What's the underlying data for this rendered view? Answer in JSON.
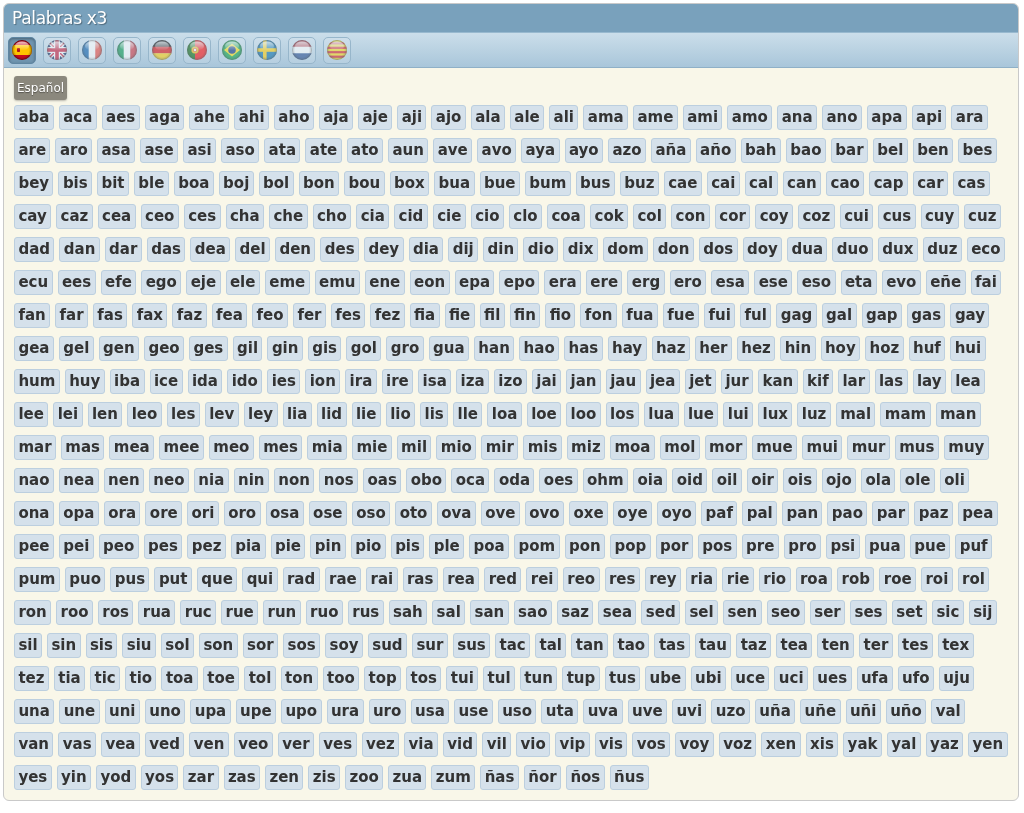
{
  "window": {
    "title": "Palabras x3"
  },
  "languages": [
    {
      "kind": "spain",
      "selected": true
    },
    {
      "kind": "uk",
      "selected": false
    },
    {
      "kind": "france",
      "selected": false
    },
    {
      "kind": "italy",
      "selected": false
    },
    {
      "kind": "germany",
      "selected": false
    },
    {
      "kind": "portugal",
      "selected": false
    },
    {
      "kind": "brazil",
      "selected": false
    },
    {
      "kind": "sweden",
      "selected": false
    },
    {
      "kind": "netherlands",
      "selected": false
    },
    {
      "kind": "catalonia",
      "selected": false
    }
  ],
  "section": {
    "label": "Español",
    "words": [
      "aba",
      "aca",
      "aes",
      "aga",
      "ahe",
      "ahi",
      "aho",
      "aja",
      "aje",
      "aji",
      "ajo",
      "ala",
      "ale",
      "ali",
      "ama",
      "ame",
      "ami",
      "amo",
      "ana",
      "ano",
      "apa",
      "api",
      "ara",
      "are",
      "aro",
      "asa",
      "ase",
      "asi",
      "aso",
      "ata",
      "ate",
      "ato",
      "aun",
      "ave",
      "avo",
      "aya",
      "ayo",
      "azo",
      "aña",
      "año",
      "bah",
      "bao",
      "bar",
      "bel",
      "ben",
      "bes",
      "bey",
      "bis",
      "bit",
      "ble",
      "boa",
      "boj",
      "bol",
      "bon",
      "bou",
      "box",
      "bua",
      "bue",
      "bum",
      "bus",
      "buz",
      "cae",
      "cai",
      "cal",
      "can",
      "cao",
      "cap",
      "car",
      "cas",
      "cay",
      "caz",
      "cea",
      "ceo",
      "ces",
      "cha",
      "che",
      "cho",
      "cia",
      "cid",
      "cie",
      "cio",
      "clo",
      "coa",
      "cok",
      "col",
      "con",
      "cor",
      "coy",
      "coz",
      "cui",
      "cus",
      "cuy",
      "cuz",
      "dad",
      "dan",
      "dar",
      "das",
      "dea",
      "del",
      "den",
      "des",
      "dey",
      "dia",
      "dij",
      "din",
      "dio",
      "dix",
      "dom",
      "don",
      "dos",
      "doy",
      "dua",
      "duo",
      "dux",
      "duz",
      "eco",
      "ecu",
      "ees",
      "efe",
      "ego",
      "eje",
      "ele",
      "eme",
      "emu",
      "ene",
      "eon",
      "epa",
      "epo",
      "era",
      "ere",
      "erg",
      "ero",
      "esa",
      "ese",
      "eso",
      "eta",
      "evo",
      "eñe",
      "fai",
      "fan",
      "far",
      "fas",
      "fax",
      "faz",
      "fea",
      "feo",
      "fer",
      "fes",
      "fez",
      "fia",
      "fie",
      "fil",
      "fin",
      "fio",
      "fon",
      "fua",
      "fue",
      "fui",
      "ful",
      "gag",
      "gal",
      "gap",
      "gas",
      "gay",
      "gea",
      "gel",
      "gen",
      "geo",
      "ges",
      "gil",
      "gin",
      "gis",
      "gol",
      "gro",
      "gua",
      "han",
      "hao",
      "has",
      "hay",
      "haz",
      "her",
      "hez",
      "hin",
      "hoy",
      "hoz",
      "huf",
      "hui",
      "hum",
      "huy",
      "iba",
      "ice",
      "ida",
      "ido",
      "ies",
      "ion",
      "ira",
      "ire",
      "isa",
      "iza",
      "izo",
      "jai",
      "jan",
      "jau",
      "jea",
      "jet",
      "jur",
      "kan",
      "kif",
      "lar",
      "las",
      "lay",
      "lea",
      "lee",
      "lei",
      "len",
      "leo",
      "les",
      "lev",
      "ley",
      "lia",
      "lid",
      "lie",
      "lio",
      "lis",
      "lle",
      "loa",
      "loe",
      "loo",
      "los",
      "lua",
      "lue",
      "lui",
      "lux",
      "luz",
      "mal",
      "mam",
      "man",
      "mar",
      "mas",
      "mea",
      "mee",
      "meo",
      "mes",
      "mia",
      "mie",
      "mil",
      "mio",
      "mir",
      "mis",
      "miz",
      "moa",
      "mol",
      "mor",
      "mue",
      "mui",
      "mur",
      "mus",
      "muy",
      "nao",
      "nea",
      "nen",
      "neo",
      "nia",
      "nin",
      "non",
      "nos",
      "oas",
      "obo",
      "oca",
      "oda",
      "oes",
      "ohm",
      "oia",
      "oid",
      "oil",
      "oir",
      "ois",
      "ojo",
      "ola",
      "ole",
      "oli",
      "ona",
      "opa",
      "ora",
      "ore",
      "ori",
      "oro",
      "osa",
      "ose",
      "oso",
      "oto",
      "ova",
      "ove",
      "ovo",
      "oxe",
      "oye",
      "oyo",
      "paf",
      "pal",
      "pan",
      "pao",
      "par",
      "paz",
      "pea",
      "pee",
      "pei",
      "peo",
      "pes",
      "pez",
      "pia",
      "pie",
      "pin",
      "pio",
      "pis",
      "ple",
      "poa",
      "pom",
      "pon",
      "pop",
      "por",
      "pos",
      "pre",
      "pro",
      "psi",
      "pua",
      "pue",
      "puf",
      "pum",
      "puo",
      "pus",
      "put",
      "que",
      "qui",
      "rad",
      "rae",
      "rai",
      "ras",
      "rea",
      "red",
      "rei",
      "reo",
      "res",
      "rey",
      "ria",
      "rie",
      "rio",
      "roa",
      "rob",
      "roe",
      "roi",
      "rol",
      "ron",
      "roo",
      "ros",
      "rua",
      "ruc",
      "rue",
      "run",
      "ruo",
      "rus",
      "sah",
      "sal",
      "san",
      "sao",
      "saz",
      "sea",
      "sed",
      "sel",
      "sen",
      "seo",
      "ser",
      "ses",
      "set",
      "sic",
      "sij",
      "sil",
      "sin",
      "sis",
      "siu",
      "sol",
      "son",
      "sor",
      "sos",
      "soy",
      "sud",
      "sur",
      "sus",
      "tac",
      "tal",
      "tan",
      "tao",
      "tas",
      "tau",
      "taz",
      "tea",
      "ten",
      "ter",
      "tes",
      "tex",
      "tez",
      "tia",
      "tic",
      "tio",
      "toa",
      "toe",
      "tol",
      "ton",
      "too",
      "top",
      "tos",
      "tui",
      "tul",
      "tun",
      "tup",
      "tus",
      "ube",
      "ubi",
      "uce",
      "uci",
      "ues",
      "ufa",
      "ufo",
      "uju",
      "una",
      "une",
      "uni",
      "uno",
      "upa",
      "upe",
      "upo",
      "ura",
      "uro",
      "usa",
      "use",
      "uso",
      "uta",
      "uva",
      "uve",
      "uvi",
      "uzo",
      "uña",
      "uñe",
      "uñi",
      "uño",
      "val",
      "van",
      "vas",
      "vea",
      "ved",
      "ven",
      "veo",
      "ver",
      "ves",
      "vez",
      "via",
      "vid",
      "vil",
      "vio",
      "vip",
      "vis",
      "vos",
      "voy",
      "voz",
      "xen",
      "xis",
      "yak",
      "yal",
      "yaz",
      "yen",
      "yes",
      "yin",
      "yod",
      "yos",
      "zar",
      "zas",
      "zen",
      "zis",
      "zoo",
      "zua",
      "zum",
      "ñas",
      "ñor",
      "ños",
      "ñus"
    ]
  }
}
